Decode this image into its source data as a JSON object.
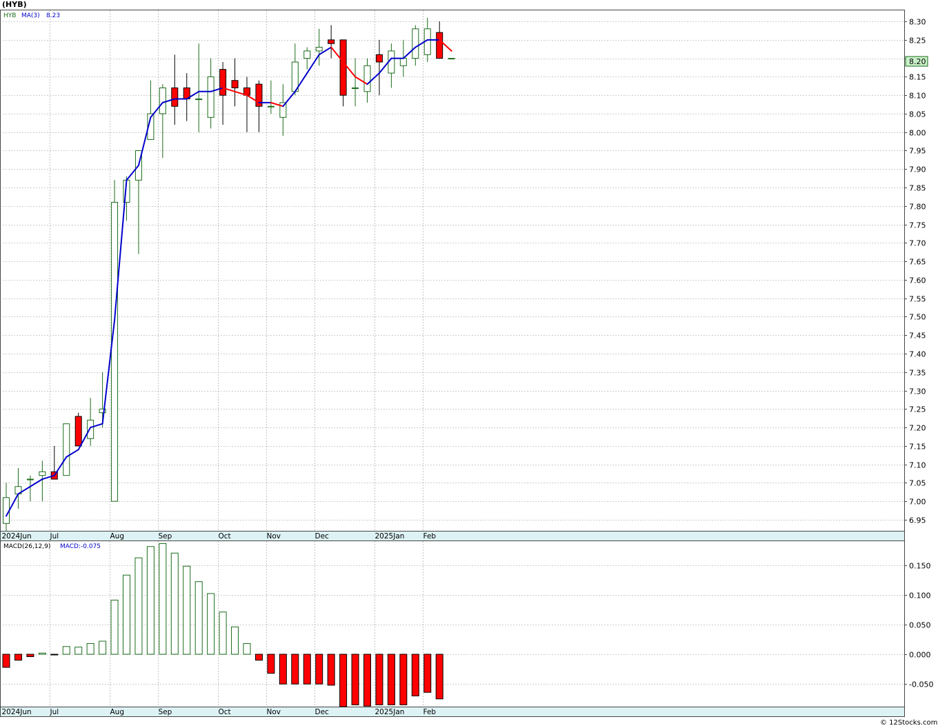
{
  "header": {
    "ticker_title": "(HYB)",
    "footer": "© 12Stocks.com"
  },
  "price_panel": {
    "legend_symbol": "HYB",
    "legend_ma": "MA(3)",
    "legend_ma_value": "8.23",
    "last_price_tag": "8.20",
    "y_ticks": [
      "6.95",
      "7.00",
      "7.05",
      "7.10",
      "7.15",
      "7.20",
      "7.25",
      "7.30",
      "7.35",
      "7.40",
      "7.45",
      "7.50",
      "7.55",
      "7.60",
      "7.65",
      "7.70",
      "7.75",
      "7.80",
      "7.85",
      "7.90",
      "7.95",
      "8.00",
      "8.05",
      "8.10",
      "8.15",
      "8.20",
      "8.25",
      "8.30"
    ]
  },
  "macd_panel": {
    "legend_name": "MACD(26,12,9)",
    "legend_value": "MACD:-0.075",
    "y_ticks": [
      "0.150",
      "0.100",
      "0.050",
      "0.000",
      "-0.050"
    ]
  },
  "x_labels": [
    "2024Jun",
    "Jul",
    "Aug",
    "Sep",
    "Oct",
    "Nov",
    "Dec",
    "2025Jan",
    "Feb"
  ],
  "colors": {
    "up_candle_border": "#1a6b1a",
    "down_candle_fill": "#ff0000",
    "ma_up": "#0000cc",
    "ma_down": "#ff0000",
    "grid": "#999999",
    "axis_separator": "#ddf2f4",
    "price_tag_bg": "#c8f0c8"
  },
  "chart_data": [
    {
      "type": "candlestick",
      "title": "(HYB)",
      "period": "weekly",
      "ylim": [
        6.92,
        8.33
      ],
      "x_month_labels": [
        {
          "label": "2024Jun",
          "week": 0
        },
        {
          "label": "Jul",
          "week": 4
        },
        {
          "label": "Aug",
          "week": 9
        },
        {
          "label": "Sep",
          "week": 13
        },
        {
          "label": "Oct",
          "week": 18
        },
        {
          "label": "Nov",
          "week": 22
        },
        {
          "label": "Dec",
          "week": 26
        },
        {
          "label": "2025Jan",
          "week": 31
        },
        {
          "label": "Feb",
          "week": 35
        }
      ],
      "candles": [
        {
          "o": 6.94,
          "h": 7.05,
          "l": 6.92,
          "c": 7.01
        },
        {
          "o": 7.02,
          "h": 7.09,
          "l": 6.98,
          "c": 7.04
        },
        {
          "o": 7.06,
          "h": 7.07,
          "l": 7.0,
          "c": 7.06
        },
        {
          "o": 7.07,
          "h": 7.11,
          "l": 7.0,
          "c": 7.08
        },
        {
          "o": 7.08,
          "h": 7.15,
          "l": 7.06,
          "c": 7.06
        },
        {
          "o": 7.07,
          "h": 7.21,
          "l": 7.07,
          "c": 7.21
        },
        {
          "o": 7.23,
          "h": 7.24,
          "l": 7.15,
          "c": 7.15
        },
        {
          "o": 7.17,
          "h": 7.28,
          "l": 7.15,
          "c": 7.22
        },
        {
          "o": 7.24,
          "h": 7.35,
          "l": 7.2,
          "c": 7.25
        },
        {
          "o": 7.0,
          "h": 7.87,
          "l": 7.0,
          "c": 7.81
        },
        {
          "o": 7.81,
          "h": 7.88,
          "l": 7.76,
          "c": 7.87
        },
        {
          "o": 7.87,
          "h": 7.95,
          "l": 7.67,
          "c": 7.95
        },
        {
          "o": 7.98,
          "h": 8.14,
          "l": 7.98,
          "c": 8.05
        },
        {
          "o": 8.05,
          "h": 8.13,
          "l": 7.93,
          "c": 8.12
        },
        {
          "o": 8.12,
          "h": 8.21,
          "l": 8.02,
          "c": 8.07
        },
        {
          "o": 8.12,
          "h": 8.16,
          "l": 8.03,
          "c": 8.09
        },
        {
          "o": 8.09,
          "h": 8.24,
          "l": 8.0,
          "c": 8.09
        },
        {
          "o": 8.04,
          "h": 8.2,
          "l": 8.01,
          "c": 8.15
        },
        {
          "o": 8.17,
          "h": 8.19,
          "l": 8.02,
          "c": 8.1
        },
        {
          "o": 8.14,
          "h": 8.2,
          "l": 8.07,
          "c": 8.12
        },
        {
          "o": 8.12,
          "h": 8.15,
          "l": 8.0,
          "c": 8.1
        },
        {
          "o": 8.13,
          "h": 8.14,
          "l": 8.0,
          "c": 8.07
        },
        {
          "o": 8.07,
          "h": 8.14,
          "l": 8.05,
          "c": 8.07
        },
        {
          "o": 8.04,
          "h": 8.13,
          "l": 7.99,
          "c": 8.08
        },
        {
          "o": 8.11,
          "h": 8.24,
          "l": 8.1,
          "c": 8.19
        },
        {
          "o": 8.2,
          "h": 8.23,
          "l": 8.17,
          "c": 8.22
        },
        {
          "o": 8.22,
          "h": 8.28,
          "l": 8.18,
          "c": 8.23
        },
        {
          "o": 8.25,
          "h": 8.29,
          "l": 8.2,
          "c": 8.24
        },
        {
          "o": 8.25,
          "h": 8.25,
          "l": 8.07,
          "c": 8.1
        },
        {
          "o": 8.12,
          "h": 8.2,
          "l": 8.07,
          "c": 8.12
        },
        {
          "o": 8.11,
          "h": 8.2,
          "l": 8.08,
          "c": 8.18
        },
        {
          "o": 8.21,
          "h": 8.25,
          "l": 8.1,
          "c": 8.19
        },
        {
          "o": 8.16,
          "h": 8.24,
          "l": 8.12,
          "c": 8.22
        },
        {
          "o": 8.18,
          "h": 8.25,
          "l": 8.15,
          "c": 8.2
        },
        {
          "o": 8.2,
          "h": 8.29,
          "l": 8.18,
          "c": 8.28
        },
        {
          "o": 8.21,
          "h": 8.31,
          "l": 8.19,
          "c": 8.28
        },
        {
          "o": 8.27,
          "h": 8.3,
          "l": 8.2,
          "c": 8.2
        },
        {
          "o": 8.2,
          "h": 8.2,
          "l": 8.2,
          "c": 8.2
        }
      ],
      "ma3": [
        6.96,
        7.02,
        7.04,
        7.06,
        7.07,
        7.12,
        7.14,
        7.2,
        7.21,
        7.49,
        7.87,
        7.91,
        8.04,
        8.08,
        8.09,
        8.09,
        8.11,
        8.11,
        8.12,
        8.11,
        8.1,
        8.08,
        8.08,
        8.07,
        8.11,
        8.16,
        8.21,
        8.23,
        8.19,
        8.15,
        8.13,
        8.16,
        8.2,
        8.2,
        8.23,
        8.25,
        8.25,
        8.22
      ],
      "ma3_color_by_segment": "blue when rising, red when falling"
    },
    {
      "type": "bar",
      "title": "MACD(26,12,9)",
      "ylim": [
        -0.088,
        0.19
      ],
      "values": [
        -0.022,
        -0.01,
        -0.004,
        0.002,
        -0.001,
        0.013,
        0.012,
        0.018,
        0.022,
        0.091,
        0.133,
        0.162,
        0.181,
        0.186,
        0.17,
        0.148,
        0.122,
        0.102,
        0.071,
        0.046,
        0.018,
        -0.01,
        -0.032,
        -0.05,
        -0.05,
        -0.05,
        -0.05,
        -0.052,
        -0.088,
        -0.085,
        -0.087,
        -0.085,
        -0.085,
        -0.085,
        -0.07,
        -0.064,
        -0.075
      ]
    }
  ]
}
